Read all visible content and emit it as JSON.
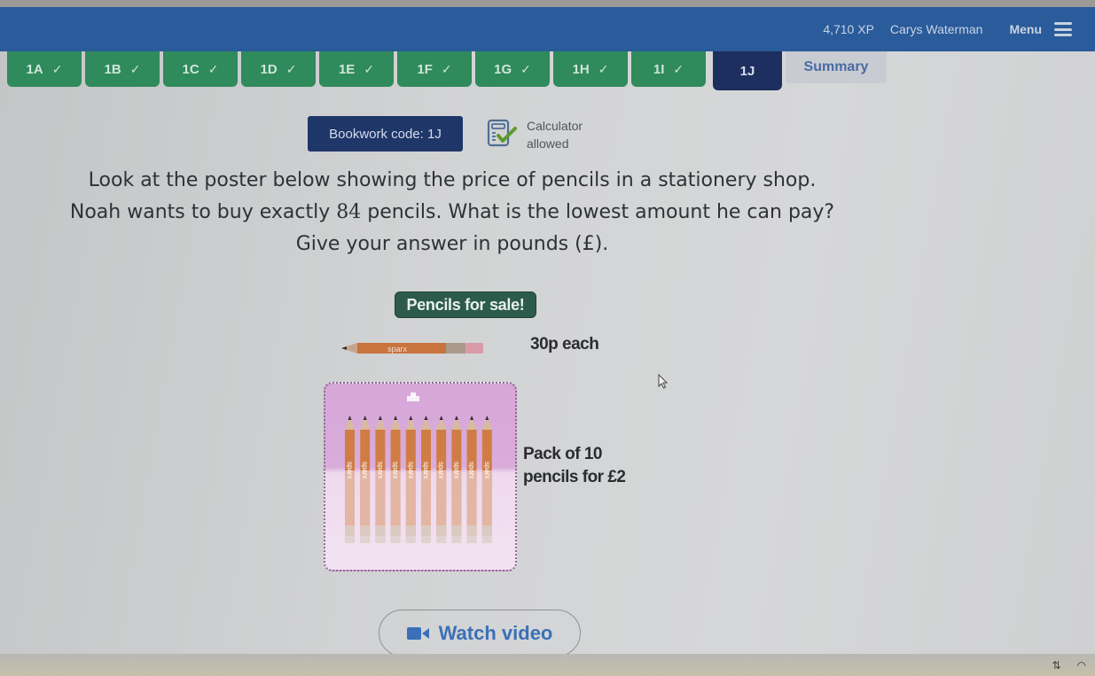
{
  "topbar": {
    "xp": "4,710 XP",
    "user_name": "Carys Waterman",
    "menu_label": "Menu",
    "menu_icon": "hamburger-icon",
    "background_color": "#2a5b9a"
  },
  "tabs": [
    {
      "label": "1A",
      "completed": true
    },
    {
      "label": "1B",
      "completed": true
    },
    {
      "label": "1C",
      "completed": true
    },
    {
      "label": "1D",
      "completed": true
    },
    {
      "label": "1E",
      "completed": true
    },
    {
      "label": "1F",
      "completed": true
    },
    {
      "label": "1G",
      "completed": true
    },
    {
      "label": "1H",
      "completed": true
    },
    {
      "label": "1I",
      "completed": true
    },
    {
      "label": "1J",
      "completed": false,
      "active": true
    },
    {
      "label": "Summary",
      "completed": false
    }
  ],
  "tab_colors": {
    "completed": "#2f8a5c",
    "active": "#1d2f5e",
    "summary": "#c8ccd2"
  },
  "check_glyph": "✓",
  "bookwork": {
    "label": "Bookwork code: 1J"
  },
  "calculator": {
    "line1": "Calculator",
    "line2": "allowed",
    "icon": "calculator-check-icon"
  },
  "question": {
    "line1": "Look at the poster below showing the price of pencils in a stationery shop.",
    "line2_pre": "Noah wants to buy exactly ",
    "line2_num": "84",
    "line2_post": " pencils. What is the lowest amount he can pay?",
    "line3": "Give your answer in pounds (£)."
  },
  "poster": {
    "title": "Pencils for sale!",
    "single_price": "30p each",
    "pencil_brand": "sparx",
    "pack_line1": "Pack of 10",
    "pack_line2": "pencils for £2",
    "pack_count": 10
  },
  "watch_video": {
    "label": "Watch video",
    "icon": "video-camera-icon"
  }
}
